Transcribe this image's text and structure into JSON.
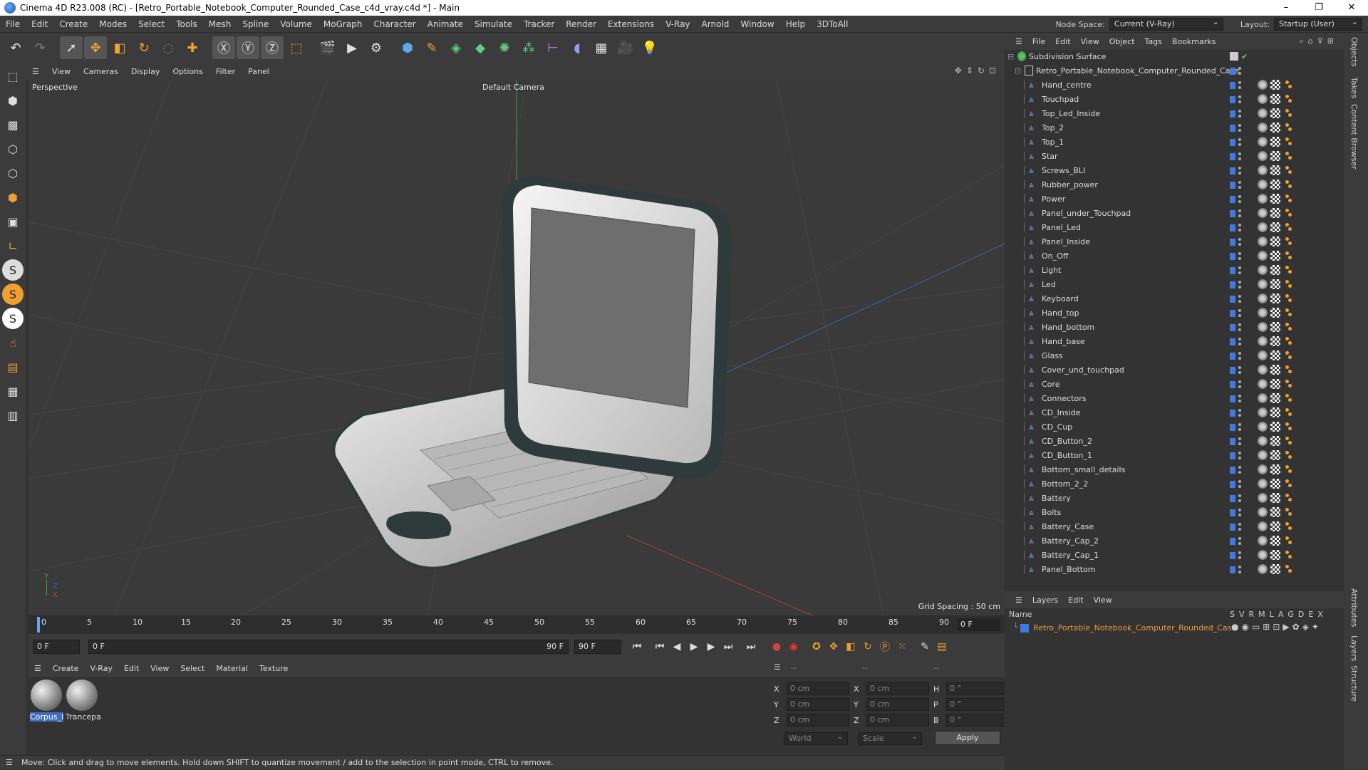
{
  "title_bar": {
    "title": "Cinema 4D R23.008 (RC) - [Retro_Portable_Notebook_Computer_Rounded_Case_c4d_vray.c4d *] - Main",
    "minimize": "–",
    "maximize": "❐",
    "close": "✕"
  },
  "menu": [
    "File",
    "Edit",
    "Create",
    "Modes",
    "Select",
    "Tools",
    "Mesh",
    "Spline",
    "Volume",
    "MoGraph",
    "Character",
    "Animate",
    "Simulate",
    "Tracker",
    "Render",
    "Extensions",
    "V-Ray",
    "Arnold",
    "Window",
    "Help",
    "3DToAll"
  ],
  "node_space": {
    "label": "Node Space:",
    "value": "Current (V-Ray)"
  },
  "layout": {
    "label": "Layout:",
    "value": "Startup (User)"
  },
  "toolbar_icons": [
    "undo-icon",
    "redo-icon",
    "select-icon",
    "move-icon",
    "scale-icon",
    "rotate-icon",
    "live-select-icon",
    "add-icon",
    "x-axis-icon",
    "y-axis-icon",
    "z-axis-icon",
    "coordinate-system-icon",
    "render-region-icon",
    "render-view-icon",
    "render-settings-icon",
    "cube-icon",
    "pen-icon",
    "subdivision-icon",
    "extrude-icon",
    "array-icon",
    "instance-icon",
    "ruler-icon",
    "deformer-icon",
    "floor-icon",
    "camera-icon",
    "light-icon"
  ],
  "viewport": {
    "menu": [
      "View",
      "Cameras",
      "Display",
      "Options",
      "Filter",
      "Panel"
    ],
    "name": "Perspective",
    "camera": "Default Camera",
    "grid_spacing": "Grid Spacing : 50 cm",
    "axis": {
      "y": "Y",
      "z": "Z",
      "x": "X"
    }
  },
  "timeline": {
    "ticks": [
      "0",
      "5",
      "10",
      "15",
      "20",
      "25",
      "30",
      "35",
      "40",
      "45",
      "50",
      "55",
      "60",
      "65",
      "70",
      "75",
      "80",
      "85",
      "90"
    ],
    "current_frame": "0 F"
  },
  "transport": {
    "start": "0 F",
    "range_start": "0 F",
    "range_end": "90 F",
    "end": "90 F"
  },
  "material_menu": [
    "Create",
    "V-Ray",
    "Edit",
    "View",
    "Select",
    "Material",
    "Texture"
  ],
  "materials": [
    {
      "name": "Corpus_l",
      "selected": true
    },
    {
      "name": "Trancepa",
      "selected": false
    }
  ],
  "coords": {
    "headers": [
      "--",
      "--",
      "--"
    ],
    "rows": [
      {
        "a": "X",
        "a_val": "0 cm",
        "b": "X",
        "b_val": "0 cm",
        "c": "H",
        "c_val": "0 °"
      },
      {
        "a": "Y",
        "a_val": "0 cm",
        "b": "Y",
        "b_val": "0 cm",
        "c": "P",
        "c_val": "0 °"
      },
      {
        "a": "Z",
        "a_val": "0 cm",
        "b": "Z",
        "b_val": "0 cm",
        "c": "B",
        "c_val": "0 °"
      }
    ],
    "world": "World",
    "scale": "Scale",
    "apply": "Apply"
  },
  "status": "Move: Click and drag to move elements. Hold down SHIFT to quantize movement / add to the selection in point mode, CTRL to remove.",
  "object_manager": {
    "menu": [
      "File",
      "Edit",
      "View",
      "Object",
      "Tags",
      "Bookmarks"
    ],
    "root": "Subdivision Surface",
    "group": "Retro_Portable_Notebook_Computer_Rounded_Case",
    "objects": [
      "Hand_centre",
      "Touchpad",
      "Top_Led_Inside",
      "Top_2",
      "Top_1",
      "Star",
      "Screws_BLI",
      "Rubber_power",
      "Power",
      "Panel_under_Touchpad",
      "Panel_Led",
      "Panel_Inside",
      "On_Off",
      "Light",
      "Led",
      "Keyboard",
      "Hand_top",
      "Hand_bottom",
      "Hand_base",
      "Glass",
      "Cover_und_touchpad",
      "Core",
      "Connectors",
      "CD_Inside",
      "CD_Cup",
      "CD_Button_2",
      "CD_Button_1",
      "Bottom_small_details",
      "Bottom_2_2",
      "Battery",
      "Bolts",
      "Battery_Case",
      "Battery_Cap_2",
      "Battery_Cap_1",
      "Panel_Bottom"
    ]
  },
  "layers": {
    "menu": [
      "Layers",
      "Edit",
      "View"
    ],
    "col_name": "Name",
    "cols": [
      "S",
      "V",
      "R",
      "M",
      "L",
      "A",
      "G",
      "D",
      "E",
      "X"
    ],
    "layer_name": "Retro_Portable_Notebook_Computer_Rounded_Case",
    "layer_color": "#3d7be0"
  },
  "side_tabs": [
    "Objects",
    "Takes",
    "Content Browser",
    "Attributes",
    "Layers",
    "Structure"
  ],
  "colors": {
    "accent": "#3d7be0",
    "layer_text": "#e89a3c",
    "selection": "#3f6fbf"
  }
}
